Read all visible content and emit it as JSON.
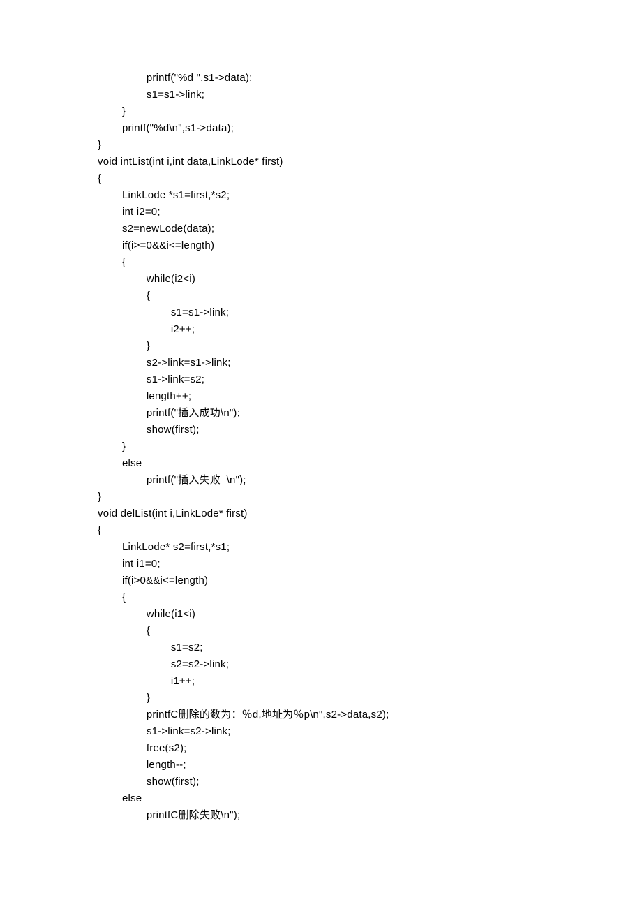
{
  "code_lines": [
    "                printf(\"%d \",s1->data);",
    "                s1=s1->link;",
    "        }",
    "        printf(\"%d\\n\",s1->data);",
    "}",
    "void intList(int i,int data,LinkLode* first)",
    "{",
    "        LinkLode *s1=first,*s2;",
    "        int i2=0;",
    "        s2=newLode(data);",
    "        if(i>=0&&i<=length)",
    "        {",
    "                while(i2<i)",
    "                {",
    "                        s1=s1->link;",
    "                        i2++;",
    "                }",
    "                s2->link=s1->link;",
    "                s1->link=s2;",
    "                length++;",
    "                printf(\"插入成功\\n\");",
    "                show(first);",
    "        }",
    "        else",
    "                printf(\"插入失败  \\n\");",
    "}",
    "void delList(int i,LinkLode* first)",
    "{",
    "        LinkLode* s2=first,*s1;",
    "        int i1=0;",
    "        if(i>0&&i<=length)",
    "        {",
    "                while(i1<i)",
    "                {",
    "                        s1=s2;",
    "                        s2=s2->link;",
    "                        i1++;",
    "                }",
    "                printfC删除的数为：％d,地址为％p\\n\",s2->data,s2);",
    "                s1->link=s2->link;",
    "                free(s2);",
    "                length--;",
    "                show(first);",
    "        else",
    "                printfC删除失败\\n\");"
  ]
}
